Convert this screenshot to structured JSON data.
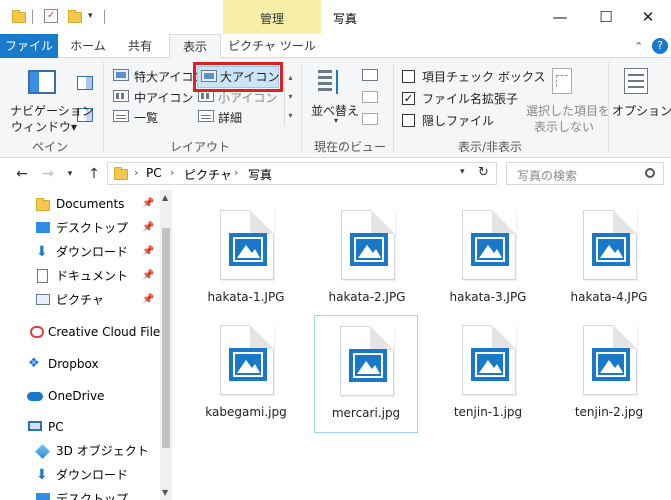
{
  "window": {
    "title": "写真",
    "context_group": "管理",
    "minimize_glyph": "—",
    "maximize_glyph": "☐",
    "close_glyph": "✕"
  },
  "tabs": [
    {
      "label": "ファイル"
    },
    {
      "label": "ホーム"
    },
    {
      "label": "共有"
    },
    {
      "label": "表示"
    },
    {
      "label": "ピクチャ ツール"
    }
  ],
  "ribbon": {
    "pane": {
      "label_line1": "ナビゲーション",
      "label_line2": "ウィンドウ▾",
      "group": "ペイン"
    },
    "layout": {
      "items": [
        "特大アイコン",
        "大アイコン",
        "中アイコン",
        "小アイコン",
        "一覧",
        "詳細"
      ],
      "group": "レイアウト"
    },
    "current_view": {
      "sort_label": "並べ替え",
      "group": "現在のビュー"
    },
    "show_hide": {
      "item_checkboxes": "項目チェック ボックス",
      "file_extensions": "ファイル名拡張子",
      "hidden_files": "隠しファイル",
      "hide_selected_line1": "選択した項目を",
      "hide_selected_line2": "表示しない",
      "group": "表示/非表示",
      "checked": [
        false,
        true,
        false
      ]
    },
    "options": {
      "label": "オプション"
    },
    "collapse_glyph": "⌃",
    "help_glyph": "?"
  },
  "addressbar": {
    "path": [
      "PC",
      "ピクチャ",
      "写真"
    ],
    "separator": "›",
    "search_placeholder": "写真の検索"
  },
  "sidebar": {
    "items": [
      {
        "label": "Documents",
        "icon": "folder-icon"
      },
      {
        "label": "デスクトップ",
        "icon": "desktop-icon"
      },
      {
        "label": "ダウンロード",
        "icon": "download-icon"
      },
      {
        "label": "ドキュメント",
        "icon": "document-icon"
      },
      {
        "label": "ピクチャ",
        "icon": "pictures-icon"
      },
      {
        "label": "Creative Cloud Files",
        "icon": "creative-cloud-icon"
      },
      {
        "label": "Dropbox",
        "icon": "dropbox-icon"
      },
      {
        "label": "OneDrive",
        "icon": "onedrive-icon"
      },
      {
        "label": "PC",
        "icon": "pc-icon"
      },
      {
        "label": "3D オブジェクト",
        "icon": "3d-objects-icon"
      },
      {
        "label": "ダウンロード",
        "icon": "download-icon"
      },
      {
        "label": "デスクトップ",
        "icon": "desktop-icon"
      }
    ]
  },
  "files": [
    {
      "name": "hakata-1.JPG"
    },
    {
      "name": "hakata-2.JPG"
    },
    {
      "name": "hakata-3.JPG"
    },
    {
      "name": "hakata-4.JPG"
    },
    {
      "name": "kabegami.jpg"
    },
    {
      "name": "mercari.jpg"
    },
    {
      "name": "tenjin-1.jpg"
    },
    {
      "name": "tenjin-2.jpg"
    }
  ],
  "colors": {
    "accent": "#1979ca",
    "highlight": "#e02020",
    "context_tab": "#f8f0a8",
    "photo_icon": "#1a78c8"
  }
}
